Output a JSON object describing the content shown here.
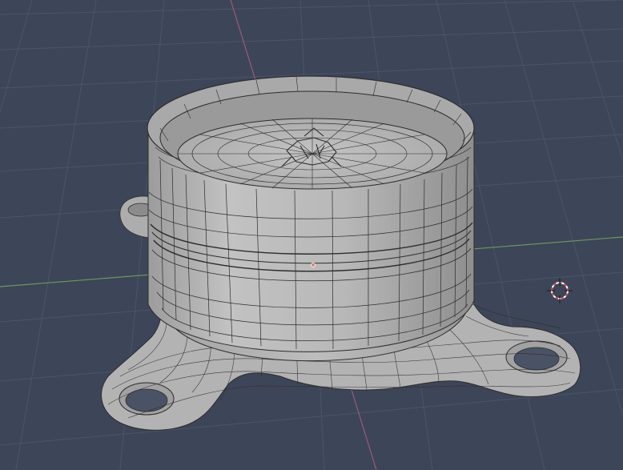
{
  "viewport": {
    "background_color": "#3d4558",
    "grid_color": "#4c5468",
    "x_axis_color": "#6a9a58",
    "y_axis_color": "#9b5a78",
    "mesh_fill_color": "#b4b4b4",
    "wire_color": "#2c2c2c",
    "origin_marker_color": "#e08080"
  },
  "scene": {
    "object_icon": "mesh-object-icon",
    "cursor_icon": "3d-cursor-icon",
    "origin_icon": "object-origin-icon"
  }
}
